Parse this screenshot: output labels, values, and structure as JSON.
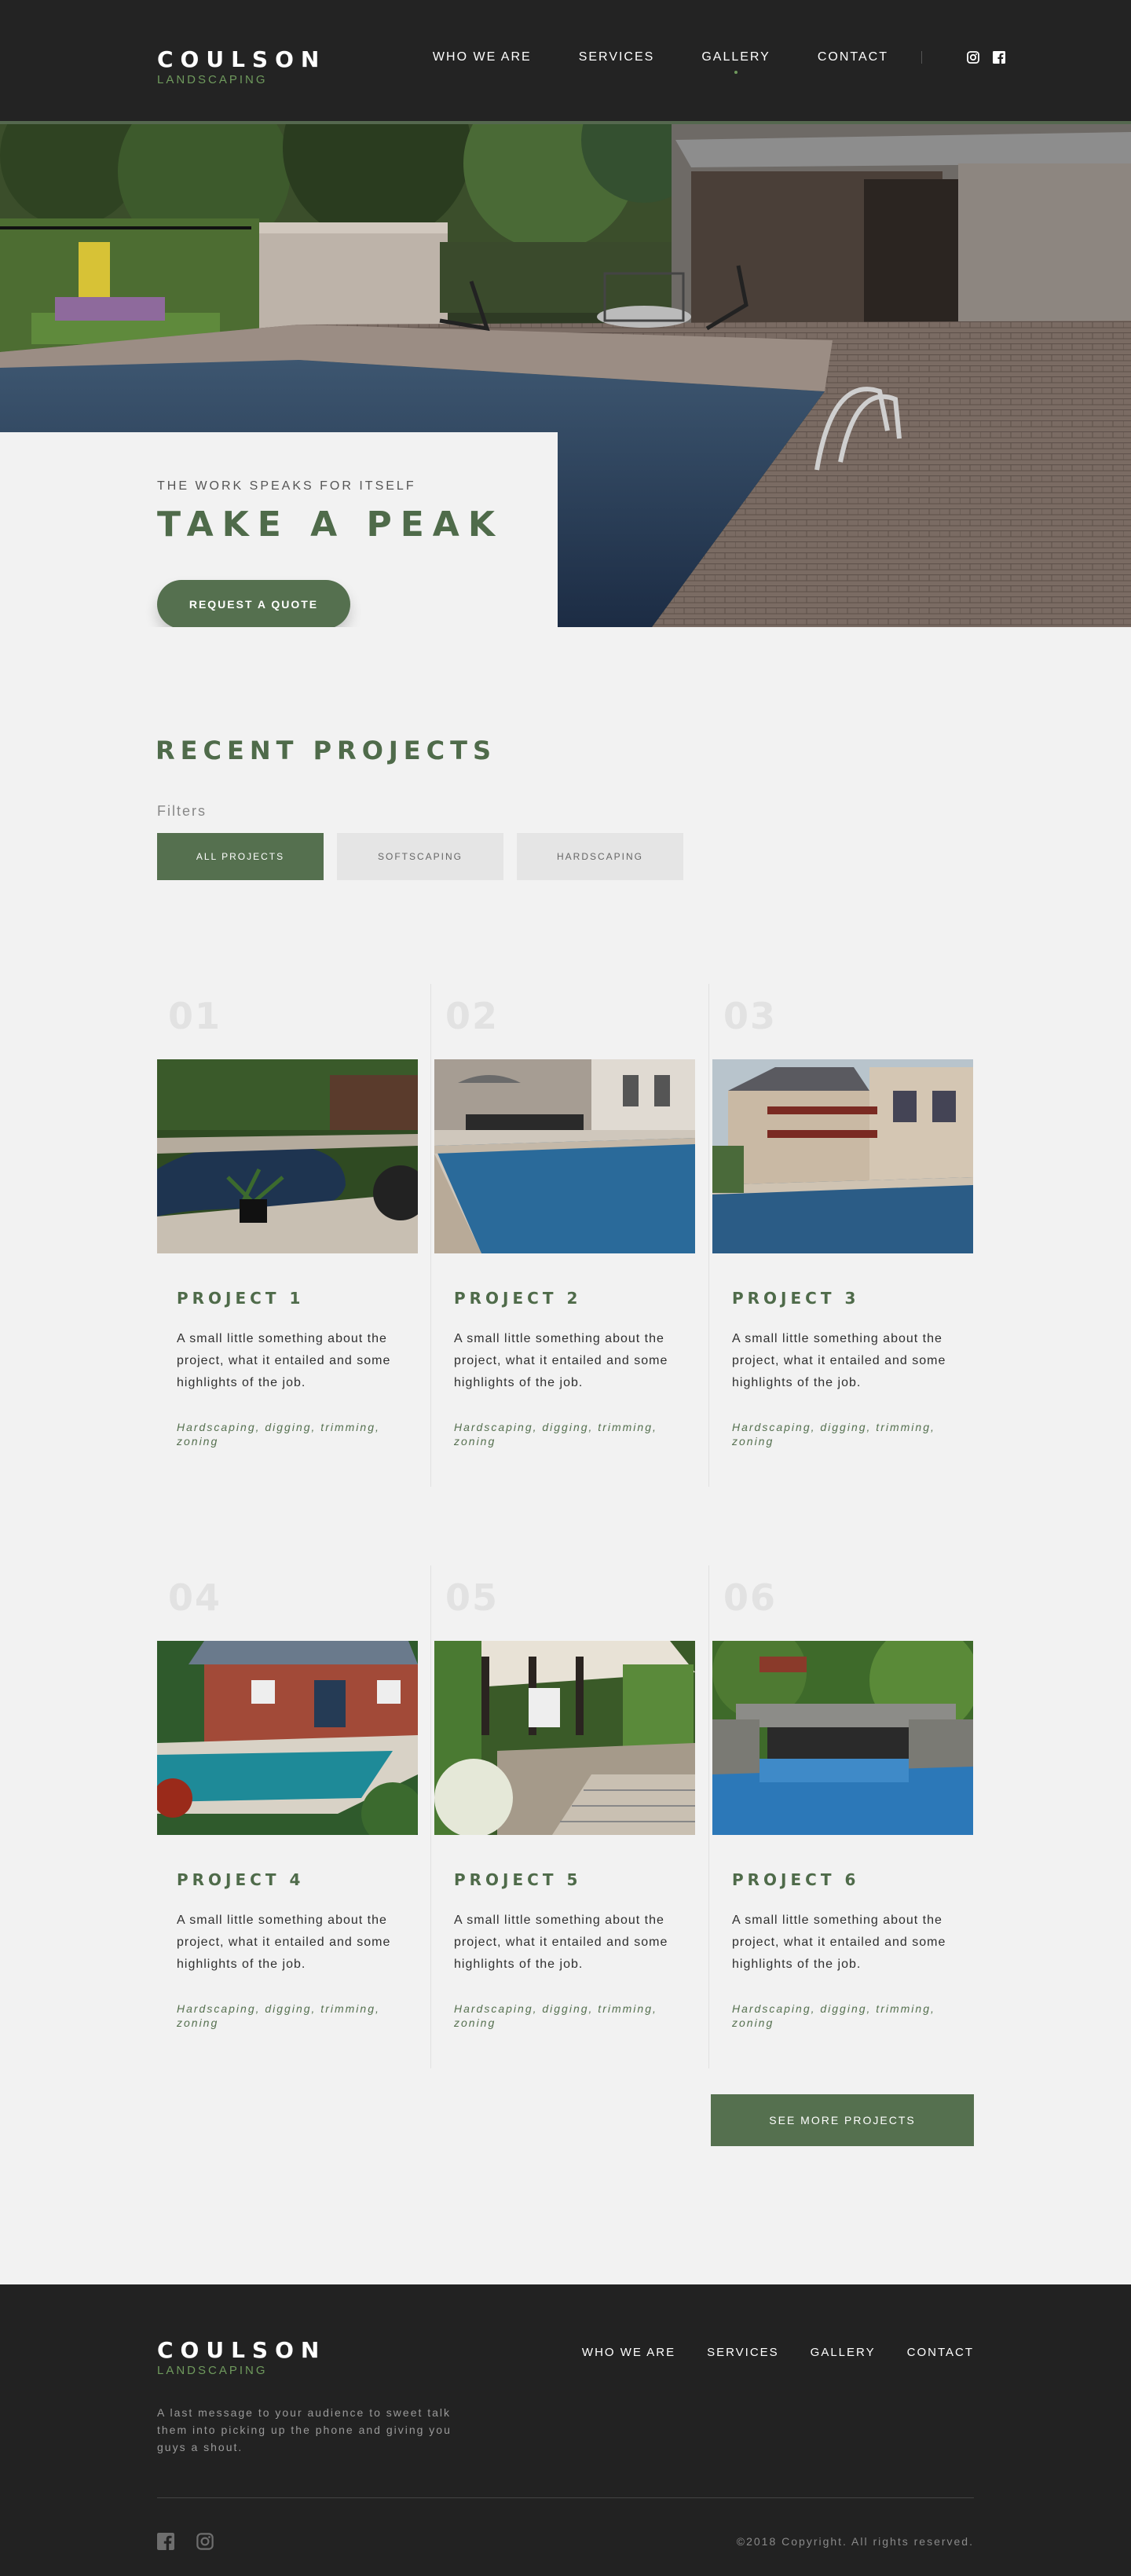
{
  "brand": {
    "name": "COULSON",
    "tagline": "LANDSCAPING",
    "accent_color": "#55704f",
    "dark_bg": "#232323"
  },
  "nav": {
    "items": [
      {
        "label": "WHO WE ARE",
        "active": false
      },
      {
        "label": "SERVICES",
        "active": false
      },
      {
        "label": "GALLERY",
        "active": true
      },
      {
        "label": "CONTACT",
        "active": false
      }
    ],
    "social": [
      "instagram-icon",
      "facebook-icon"
    ]
  },
  "hero": {
    "kicker": "THE WORK SPEAKS FOR ITSELF",
    "title": "TAKE A PEAK",
    "cta": "REQUEST A QUOTE"
  },
  "projects": {
    "title": "RECENT PROJECTS",
    "filters_label": "Filters",
    "filters": [
      {
        "label": "ALL PROJECTS",
        "active": true
      },
      {
        "label": "SOFTSCAPING",
        "active": false
      },
      {
        "label": "HARDSCAPING",
        "active": false
      }
    ],
    "items": [
      {
        "num": "01",
        "title": "PROJECT 1",
        "desc": "A small little something about the project, what it entailed and some highlights of the job.",
        "tags": "Hardscaping, digging, trimming, zoning"
      },
      {
        "num": "02",
        "title": "PROJECT 2",
        "desc": "A small little something about the project, what it entailed and some highlights of the job.",
        "tags": "Hardscaping, digging, trimming, zoning"
      },
      {
        "num": "03",
        "title": "PROJECT 3",
        "desc": "A small little something about the project, what it entailed and some highlights of the job.",
        "tags": "Hardscaping, digging, trimming, zoning"
      },
      {
        "num": "04",
        "title": "PROJECT 4",
        "desc": "A small little something about the project, what it entailed and some highlights of the job.",
        "tags": "Hardscaping, digging, trimming, zoning"
      },
      {
        "num": "05",
        "title": "PROJECT 5",
        "desc": "A small little something about the project, what it entailed and some highlights of the job.",
        "tags": "Hardscaping, digging, trimming, zoning"
      },
      {
        "num": "06",
        "title": "PROJECT 6",
        "desc": "A small little something about the project, what it entailed and some highlights of the job.",
        "tags": "Hardscaping, digging, trimming, zoning"
      }
    ],
    "more_label": "SEE MORE PROJECTS"
  },
  "footer": {
    "message": "A last message to your audience to sweet talk them into picking up the phone and giving you guys a shout.",
    "links": [
      "WHO WE ARE",
      "SERVICES",
      "GALLERY",
      "CONTACT"
    ],
    "social": [
      "facebook-icon",
      "instagram-icon"
    ],
    "copyright": "©2018 Copyright. All rights reserved."
  }
}
